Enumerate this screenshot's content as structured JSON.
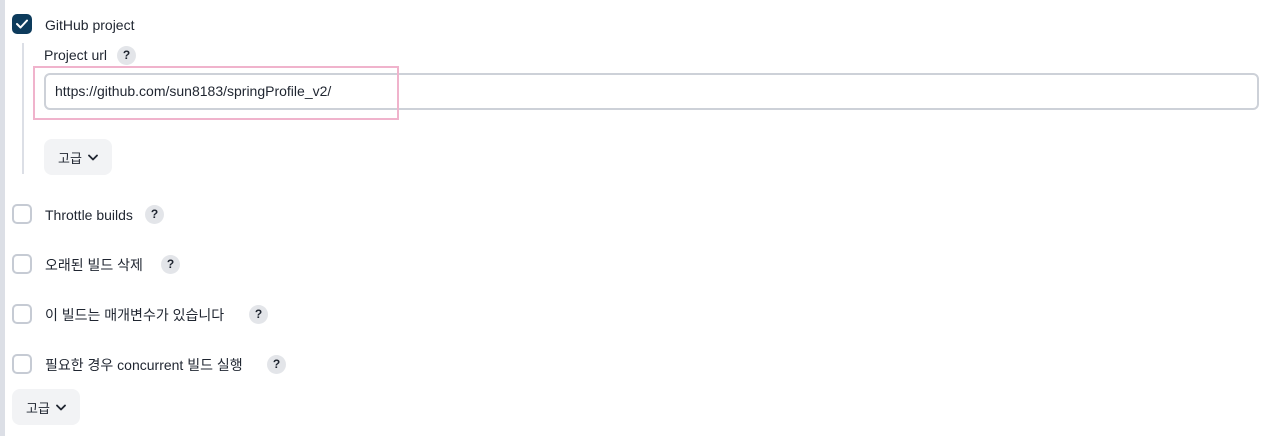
{
  "github_project": {
    "label": "GitHub project",
    "checked": true,
    "project_url_label": "Project url",
    "project_url_value": "https://github.com/sun8183/springProfile_v2/",
    "advanced_label": "고급"
  },
  "options": [
    {
      "label": "Throttle builds",
      "checked": false
    },
    {
      "label": "오래된 빌드 삭제",
      "checked": false
    },
    {
      "label": "이 빌드는 매개변수가 있습니다",
      "checked": false
    },
    {
      "label": "필요한 경우 concurrent 빌드 실행",
      "checked": false
    }
  ],
  "help_symbol": "?",
  "advanced_label": "고급",
  "icons": {
    "check": "check-icon",
    "chevron": "chevron-down-icon"
  },
  "colors": {
    "checkbox_checked": "#0d3b5c",
    "highlight": "#f0b3cc"
  }
}
